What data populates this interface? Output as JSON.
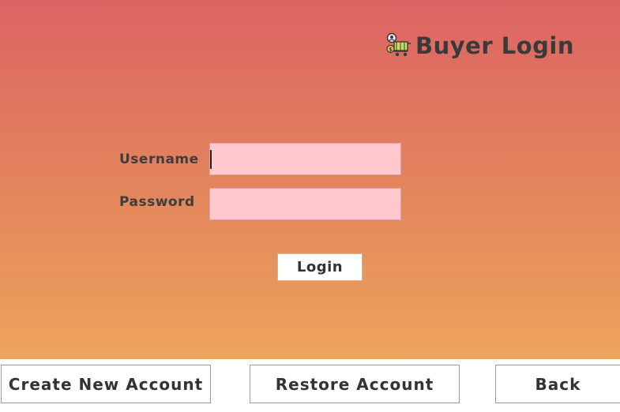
{
  "header": {
    "title": "Buyer Login",
    "icon": "shopping-cart-user-icon"
  },
  "form": {
    "username_label": "Username",
    "username_value": "",
    "password_label": "Password",
    "password_value": "",
    "login_label": "Login"
  },
  "footer": {
    "create_account_label": "Create New Account",
    "restore_account_label": "Restore Account",
    "back_label": "Back"
  },
  "colors": {
    "gradient_top": "#dd6363",
    "gradient_bottom": "#eda55c",
    "field_background": "#ffc8cc",
    "button_background": "#ffffff"
  }
}
